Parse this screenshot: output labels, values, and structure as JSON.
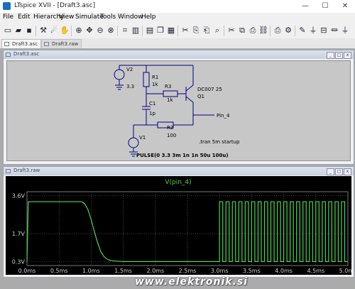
{
  "app": {
    "title": "LTspice XVII - [Draft3.asc]",
    "minimize": "—",
    "maximize": "☐",
    "close": "✕"
  },
  "menu": [
    "File",
    "Edit",
    "Hierarchy",
    "View",
    "Simulate",
    "Tools",
    "Window",
    "Help"
  ],
  "toolbar": {
    "icons": [
      "new-icon",
      "open-icon",
      "save-icon",
      "control-panel-icon",
      "run-icon",
      "halt-icon",
      "zoom-in-icon",
      "pan-icon",
      "zoom-out-icon",
      "zoom-fit-icon",
      "autorange-icon",
      "tile-vertical-icon",
      "tile-horizontal-icon",
      "cascade-icon",
      "cut-icon",
      "copy-icon",
      "paste-icon",
      "find-icon",
      "print-icon",
      "setup-icon",
      "wire-icon",
      "ground-icon",
      "label-icon",
      "resistor-icon",
      "capacitor-icon",
      "inductor-icon",
      "diode-icon",
      "component-icon",
      "move-icon",
      "drag-icon",
      "undo-icon",
      "redo-icon",
      "rotate-icon",
      "mirror-icon",
      "text-icon",
      "spice-directive-icon"
    ]
  },
  "tabs": [
    {
      "label": "Draft3.asc",
      "active": true
    },
    {
      "label": "Draft3.raw",
      "active": false
    }
  ],
  "schematic": {
    "title": "Draft3.asc",
    "v2_name": "V2",
    "v2_value": "3.3",
    "r1_name": "R1",
    "r1_value": "1k",
    "r3_name": "R3",
    "r3_value": "1k",
    "q_model": "DC007 25",
    "q_name": "Q1",
    "c1_name": "C1",
    "c1_value": "1p",
    "net_label": "Pin_4",
    "r2_name": "R2",
    "r2_value": "100",
    "v1_name": "V1",
    "v1_value": "PULSE(0 3.3 3m 1n 1n 50u 100u)",
    "directive": ".tran 5m startup"
  },
  "waveform": {
    "title": "Draft3.raw"
  },
  "chart_data": {
    "type": "line",
    "title": "V(pin_4)",
    "xlabel": "",
    "ylabel": "",
    "x_ticks": [
      "0.0ms",
      "0.5ms",
      "1.0ms",
      "1.5ms",
      "2.0ms",
      "2.5ms",
      "3.0ms",
      "3.5ms",
      "4.0ms",
      "4.5ms",
      "5.0ms"
    ],
    "y_ticks": [
      "3.6V",
      "1.7V",
      "0.3V"
    ],
    "xlim": [
      0,
      5
    ],
    "ylim": [
      0.1,
      3.8
    ],
    "grid": true,
    "background": "#000000",
    "trace_color": "#4cd64c",
    "grid_color": "#777777",
    "series": [
      {
        "name": "V(pin_4)",
        "x": [
          0,
          0.02,
          0.85,
          0.9,
          0.95,
          1.0,
          1.05,
          1.1,
          1.15,
          1.2,
          1.25,
          1.3,
          1.4,
          1.5,
          3.0
        ],
        "y": [
          0.3,
          3.3,
          3.3,
          3.2,
          2.9,
          2.4,
          1.8,
          1.25,
          0.8,
          0.55,
          0.42,
          0.36,
          0.32,
          0.3,
          0.3
        ],
        "pulse": {
          "start": 3.0,
          "end": 5.0,
          "period": 0.1,
          "high": 3.3,
          "low": 0.3,
          "duty": 0.5
        }
      }
    ]
  },
  "watermark": "www.elektronik.si"
}
